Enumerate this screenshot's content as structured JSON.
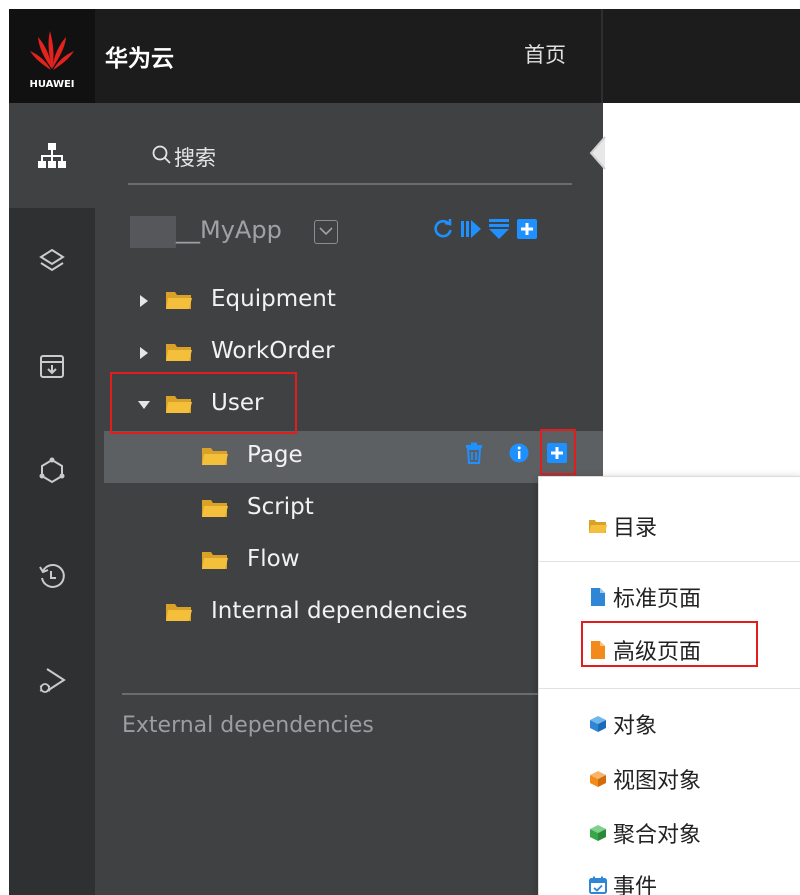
{
  "topbar": {
    "logo_text": "HUAWEI",
    "brand": "华为云",
    "home_label": "首页"
  },
  "rail": {
    "items": [
      "sitemap-icon",
      "layers-icon",
      "archive-download-icon",
      "hexagon-nodes-icon",
      "history-icon",
      "debug-play-icon"
    ]
  },
  "explorer": {
    "search_placeholder": "搜索",
    "app_name": "__MyApp",
    "tree": [
      {
        "label": "Equipment",
        "expanded": false
      },
      {
        "label": "WorkOrder",
        "expanded": false
      },
      {
        "label": "User",
        "expanded": true,
        "children": [
          {
            "label": "Page",
            "selected": true
          },
          {
            "label": "Script"
          },
          {
            "label": "Flow"
          }
        ]
      },
      {
        "label": "Internal dependencies"
      }
    ],
    "external_label": "External dependencies"
  },
  "context_menu": {
    "items": [
      {
        "label": "目录",
        "icon": "folder-icon"
      },
      {
        "label": "标准页面",
        "icon": "page-icon"
      },
      {
        "label": "高级页面",
        "icon": "page-icon"
      },
      {
        "label": "对象",
        "icon": "cube-icon"
      },
      {
        "label": "视图对象",
        "icon": "cube-icon"
      },
      {
        "label": "聚合对象",
        "icon": "cube-icon"
      },
      {
        "label": "事件",
        "icon": "calendar-icon"
      }
    ]
  },
  "colors": {
    "topbar": "#1c1c1c",
    "rail": "#2f3032",
    "panel": "#3f4143",
    "selected_row": "#5d6063",
    "accent_blue": "#1e90ff",
    "folder": "#f2b632",
    "highlight": "#e11d1d",
    "icon_orange": "#f28a1c",
    "icon_green": "#3aa64a"
  }
}
